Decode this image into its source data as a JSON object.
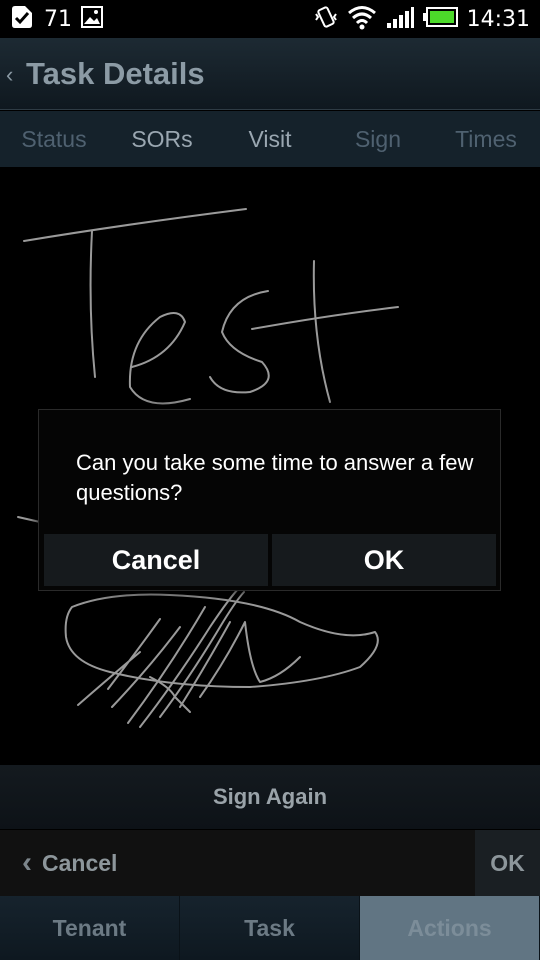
{
  "status_bar": {
    "notification_count": "71",
    "time": "14:31",
    "icons": [
      "check-notification-icon",
      "image-notification-icon",
      "vibrate-icon",
      "wifi-icon",
      "signal-icon",
      "battery-icon"
    ]
  },
  "header": {
    "back_glyph": "‹",
    "title": "Task Details"
  },
  "tabs": [
    {
      "label": "Status"
    },
    {
      "label": "SORs"
    },
    {
      "label": "Visit"
    },
    {
      "label": "Sign"
    },
    {
      "label": "Times"
    }
  ],
  "signature": {
    "sign_again_label": "Sign Again"
  },
  "bottom_actions": {
    "cancel_label": "Cancel",
    "ok_label": "OK"
  },
  "footer_tabs": [
    {
      "label": "Tenant"
    },
    {
      "label": "Task"
    },
    {
      "label": "Actions"
    }
  ],
  "dialog": {
    "message": "Can you take some time to answer a few questions?",
    "cancel_label": "Cancel",
    "ok_label": "OK"
  },
  "colors": {
    "title_bar": "#1d2a33",
    "active_footer_tab": "#617583",
    "signature_stroke": "#9a9a9a"
  }
}
